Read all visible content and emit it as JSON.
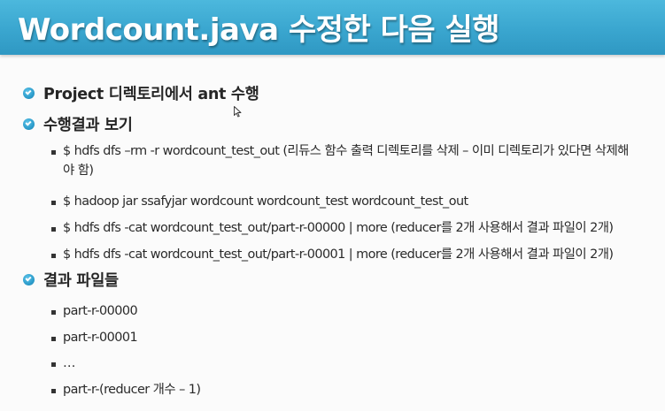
{
  "slide": {
    "title": "Wordcount.java 수정한 다음 실행",
    "bullets": [
      {
        "text": "Project 디렉토리에서 ant 수행"
      },
      {
        "text": "수행결과 보기",
        "items": [
          "$ hdfs dfs –rm -r wordcount_test_out (리듀스 함수 출력 디렉토리를 삭제 – 이미 디렉토리가 있다면 삭제해야 함)",
          "$ hadoop jar ssafyjar wordcount wordcount_test wordcount_test_out",
          "$ hdfs dfs -cat wordcount_test_out/part-r-00000 | more (reducer를 2개 사용해서 결과 파일이 2개)",
          "$ hdfs dfs -cat wordcount_test_out/part-r-00001 | more (reducer를 2개 사용해서 결과 파일이 2개)"
        ]
      },
      {
        "text": "결과 파일들",
        "items": [
          "part-r-00000",
          "part-r-00001",
          "…",
          "part-r-(reducer 개수 – 1)"
        ]
      }
    ]
  },
  "colors": {
    "title_bar": "#3aa6cf",
    "title_text": "#ffffff",
    "bullet": "#2c9ccb",
    "body_text": "#262626"
  },
  "icons": {
    "level1_bullet": "circle-check-icon",
    "level2_bullet": "square-bullet-icon",
    "cursor": "mouse-pointer-icon"
  }
}
